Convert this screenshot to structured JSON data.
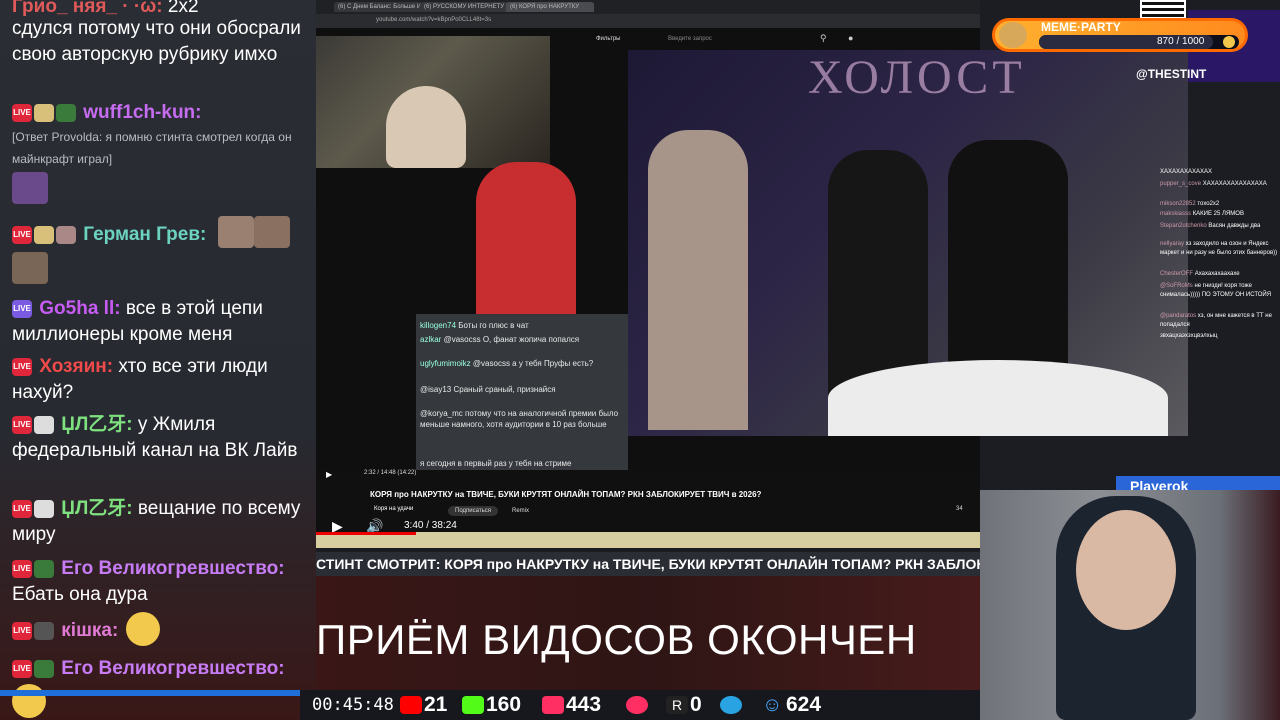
{
  "chat": {
    "messages": [
      {
        "nick": "Грио_ няя_ ·  ·ω:",
        "text": "2x2",
        "nick_color": "#e05a5a"
      },
      {
        "nick": "",
        "text": "сдулся потому что они обосрали свою авторскую рубрику имхо",
        "nick_color": "#ffffff"
      },
      {
        "nick": "wuff1ch-kun:",
        "text": "",
        "nick_color": "#c66cf0"
      },
      {
        "nick": "",
        "text": "[Ответ Provolda: я помню стинта смотрел когда он майнкрафт играл]",
        "nick_color": "#ffffff"
      },
      {
        "nick": "Герман Грев:",
        "text": "",
        "nick_color": "#6cd3c0"
      },
      {
        "nick": "Go5ha ll:",
        "text": "все в этой цепи миллионеры кроме меня",
        "nick_color": "#c65cf3"
      },
      {
        "nick": "Хозяин:",
        "text": "хто все эти люди нахуй?",
        "nick_color": "#f04a4a"
      },
      {
        "nick": "ЏЛ乙牙:",
        "text": "у Жмиля федеральный канал на ВК Лайв",
        "nick_color": "#7ee07e"
      },
      {
        "nick": "ЏЛ乙牙:",
        "text": "вещание по всему миру",
        "nick_color": "#7ee07e"
      },
      {
        "nick": "Его Великогревшество:",
        "text": "Ебать она дура",
        "nick_color": "#c77cf5"
      },
      {
        "nick": "кішка:",
        "text": "",
        "nick_color": "#e07ad4"
      },
      {
        "nick": "Его Великогревшество:",
        "text": "",
        "nick_color": "#c77cf5"
      }
    ],
    "badge_text": "LIVE"
  },
  "browser": {
    "tabs": [
      "(6) С Днем Баланс: Больше И",
      "(6) РУССКОМУ ИНТЕРНЕТУ К",
      "(6) КОРЯ про НАКРУТКУ"
    ],
    "url": "youtube.com/watch?v=kBpnPo0CLL48t=3s",
    "yt_filter": "Фильтры",
    "yt_search_placeholder": "Введите запрос"
  },
  "video_chat_overlay": [
    {
      "nick": "killogen74",
      "text": "Боты го плюс в чат"
    },
    {
      "nick": "azlkar",
      "text": "@vasocss О, фанат жопича попался"
    },
    {
      "nick": "uglyfumimoikz",
      "text": "@vasocss а у тебя Пруфы есть?"
    },
    {
      "nick": "",
      "text": "@isay13 Сраный сраный, признайся"
    },
    {
      "nick": "",
      "text": "@korya_mc потому что на аналогичной премии было меньше намного, хотя аудитории в 10 раз больше"
    },
    {
      "nick": "",
      "text": "я сегодня в первый раз у тебя на стриме"
    }
  ],
  "yt_live_chat": [
    {
      "nick": "",
      "text": "ХАХАХАХАХАХАХ"
    },
    {
      "nick": "pupper_s_cove",
      "text": "ХАХАХАХАХАХАХАХА"
    },
    {
      "nick": "mikson22852",
      "text": "тохо2х2"
    },
    {
      "nick": "makskiasss",
      "text": "КАКИЕ 25 ЛЯМОВ"
    },
    {
      "nick": "Stepan2utchenko",
      "text": "Васян давжды два"
    },
    {
      "nick": "nellyaray",
      "text": "хз заходило на озон и Яндекс маркет и ни разу не было этих баннеров))"
    },
    {
      "nick": "ChesterOFF",
      "text": "Ахахахахаахахе"
    },
    {
      "nick": "@SoFRoMs",
      "text": "не гнизди! коря тоже снималась))))) ПО ЭТОМУ ОН ИСТОЙЯ"
    },
    {
      "nick": "@pandaratos",
      "text": "хз, он мне кажется в ТТ не попадался"
    },
    {
      "nick": "",
      "text": "звхацхаэхзхцвэлхыц"
    }
  ],
  "player": {
    "elapsed_small": "2:32 / 14:48 (14:22)",
    "title": "КОРЯ про НАКРУТКУ на ТВИЧЕ, БУКИ КРУТЯТ ОНЛАЙН ТОПАМ? РКН ЗАБЛОКИРУЕТ ТВИЧ в 2026?",
    "time": "3:40 / 38:24",
    "subscribe": "Подписаться",
    "channel": "Коря на удачи",
    "remix": "Remix",
    "likes": "34",
    "progress_fraction": 0.15
  },
  "banner": "СТИНТ СМОТРИТ: КОРЯ про НАКРУТКУ на ТВИЧЕ, БУКИ КРУТЯТ ОНЛАЙН ТОПАМ? РКН ЗАБЛОКИРУЕТ",
  "notice": "ПРИЁМ ВИДОСОВ ОКОНЧЕН",
  "stats": {
    "uptime": "00:45:48",
    "youtube": "21",
    "kick": "160",
    "vklive": "443",
    "rutube": "0",
    "telegram": "",
    "viewers": "624",
    "colors": {
      "youtube": "#ff0000",
      "kick": "#53fc18",
      "vklive": "#ff2e63",
      "total": "#4aa8ff"
    }
  },
  "meme_party": {
    "title": "MEME·PARTY",
    "value": "870 / 1000",
    "fraction": 0.87
  },
  "handle": "@THESTINT",
  "playerok": "Playerok",
  "colors": {
    "accent": "#ff8b1e",
    "live": "#e0263b",
    "chat_bg": "#2a2d34"
  }
}
